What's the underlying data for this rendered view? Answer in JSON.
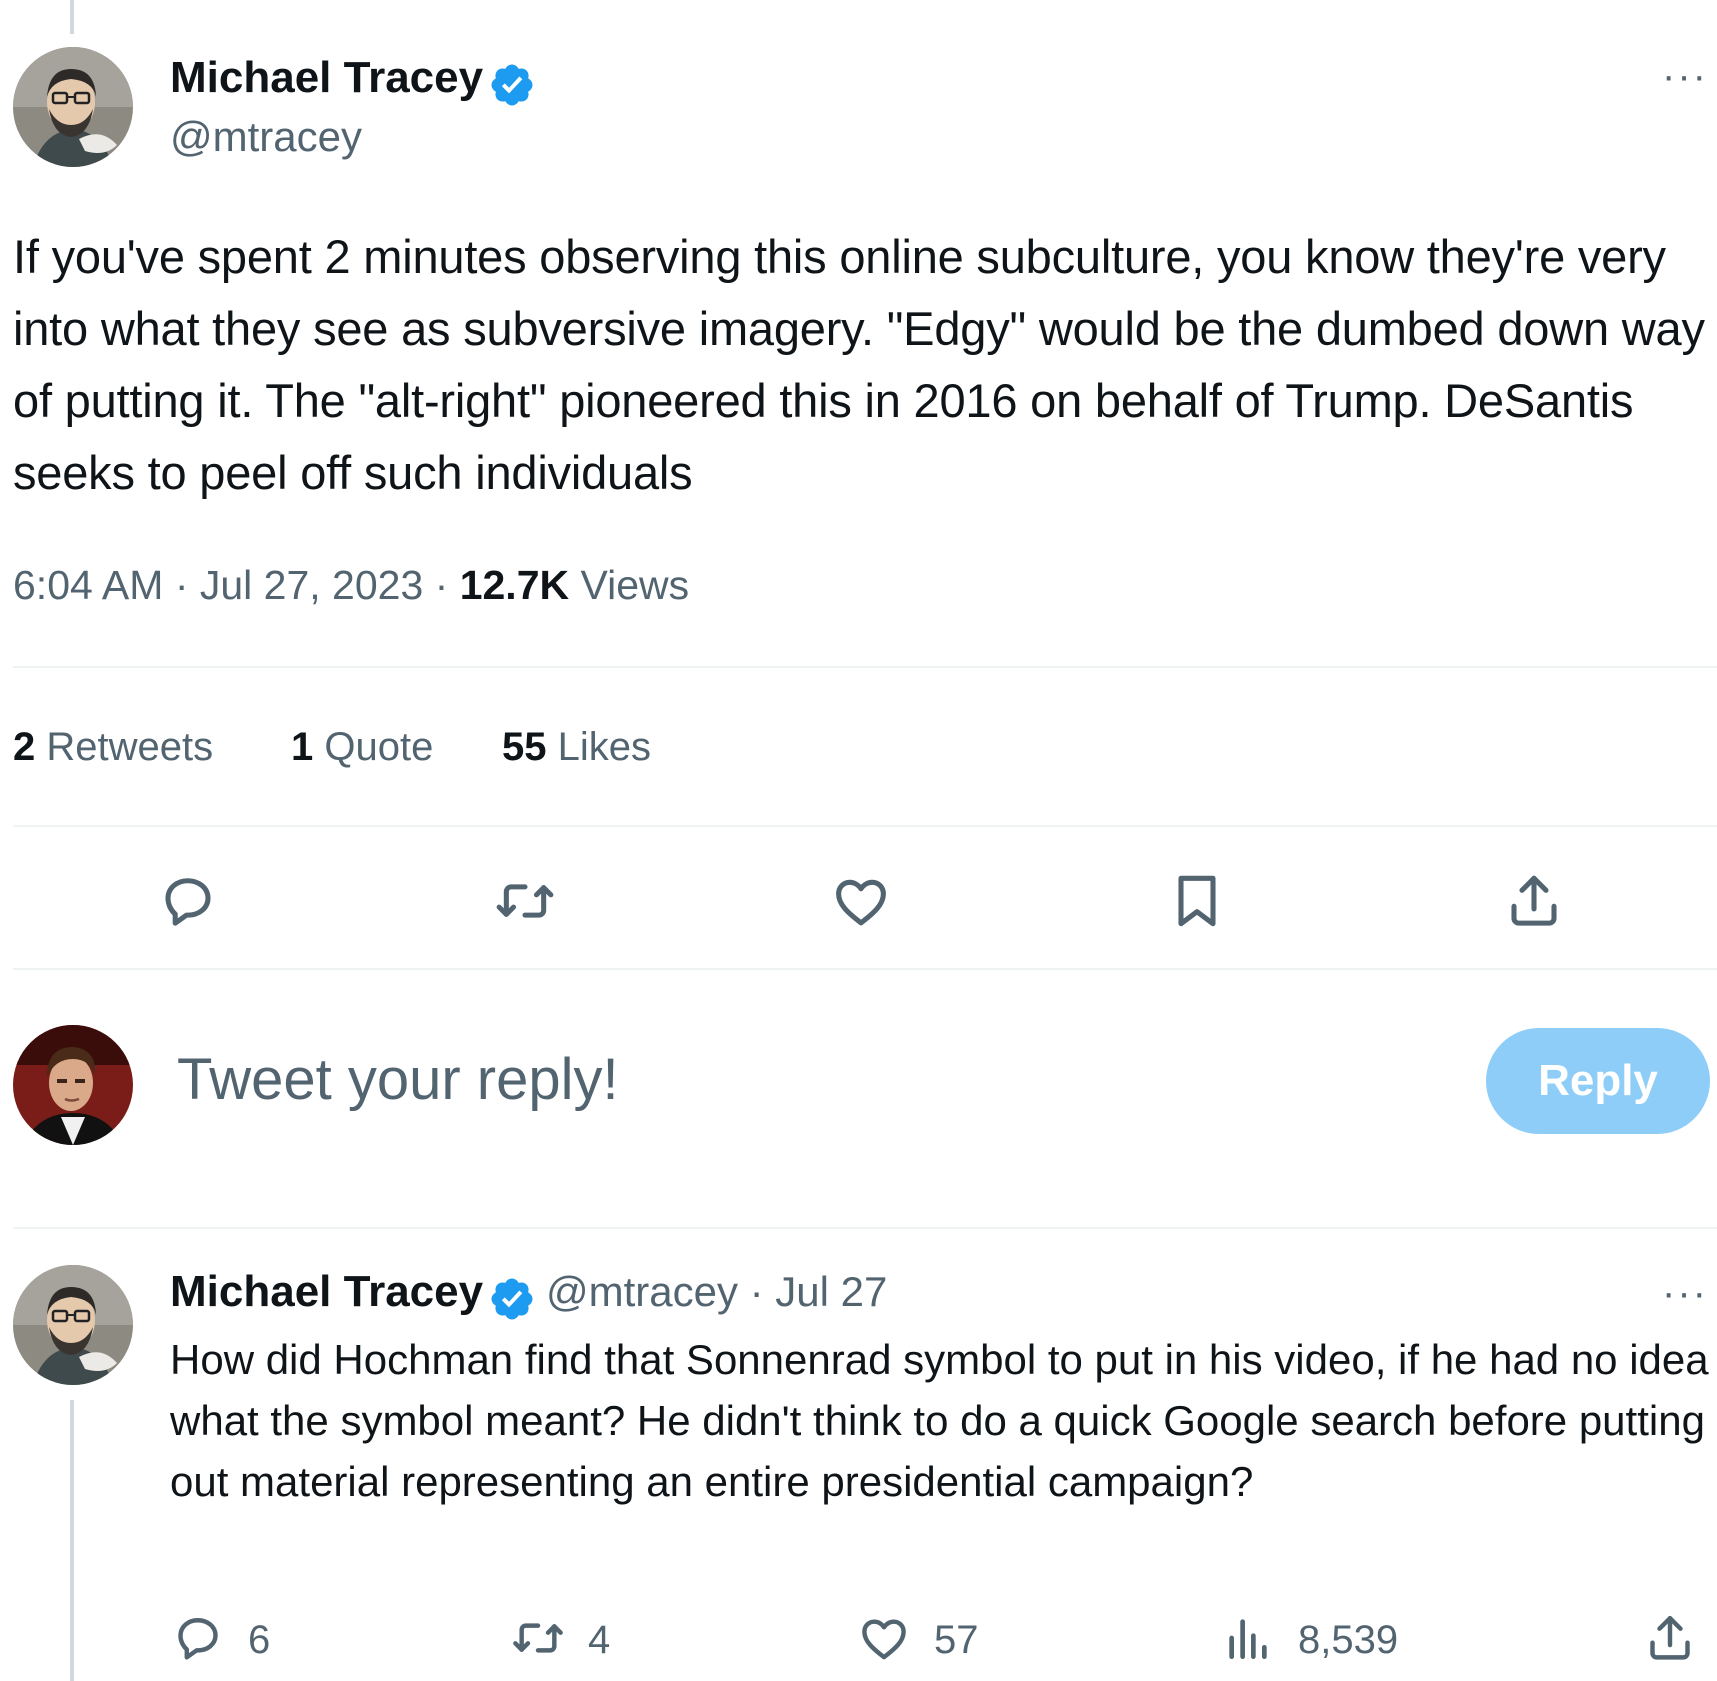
{
  "main_tweet": {
    "author_name": "Michael Tracey",
    "handle": "@mtracey",
    "more_glyph": "···",
    "text": "If you've spent 2 minutes observing this online subculture, you know they're very into what they see as subversive imagery. \"Edgy\" would be the dumbed down way of putting it. The \"alt-right\" pioneered this in 2016 on behalf of Trump. DeSantis seeks to peel off such individuals",
    "time": "6:04 AM · Jul 27, 2023 · ",
    "views_count": "12.7K",
    "views_label": " Views",
    "stats": {
      "retweets_count": "2",
      "retweets_label": " Retweets",
      "quote_count": "1",
      "quote_label": " Quote",
      "likes_count": "55",
      "likes_label": " Likes"
    },
    "actions": [
      "reply-icon",
      "retweet-icon",
      "like-icon",
      "bookmark-icon",
      "share-icon"
    ]
  },
  "composer": {
    "placeholder": "Tweet your reply!",
    "button_label": "Reply"
  },
  "reply_tweet": {
    "author_name": "Michael Tracey",
    "handle_time": "@mtracey · Jul 27",
    "more_glyph": "···",
    "text": "How did Hochman find that Sonnenrad symbol to put in his video, if he had no idea what the symbol meant? He didn't think to do a quick Google search before putting out material representing an entire presidential campaign?",
    "replies": "6",
    "retweets": "4",
    "likes": "57",
    "views": "8,539"
  },
  "colors": {
    "verified": "#1d9bf0",
    "icon": "#536471",
    "reply_button": "#8ecdf8",
    "divider": "#eff3f4"
  }
}
